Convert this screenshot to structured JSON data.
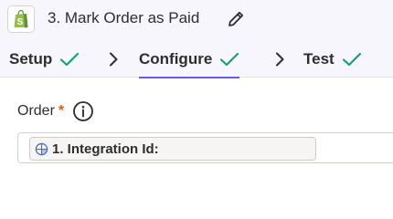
{
  "header": {
    "app_icon": "shopify-bag-icon",
    "title": "3. Mark Order as Paid",
    "edit_icon": "pencil-icon"
  },
  "tabs": [
    {
      "label": "Setup",
      "status_icon": "check-icon",
      "active": false
    },
    {
      "label": "Configure",
      "status_icon": "check-icon",
      "active": true
    },
    {
      "label": "Test",
      "status_icon": "check-icon",
      "active": false
    }
  ],
  "colors": {
    "header_bg": "#f7f6fd",
    "check_green": "#13a36f",
    "active_underline": "#695be8",
    "required_orange": "#ff4f00",
    "shopify_green": "#95bf47"
  },
  "field": {
    "label": "Order",
    "required_mark": "*",
    "info_icon": "info-circle-icon",
    "mapped_value": {
      "icon": "integration-globe-icon",
      "text": "1. Integration Id:"
    }
  }
}
